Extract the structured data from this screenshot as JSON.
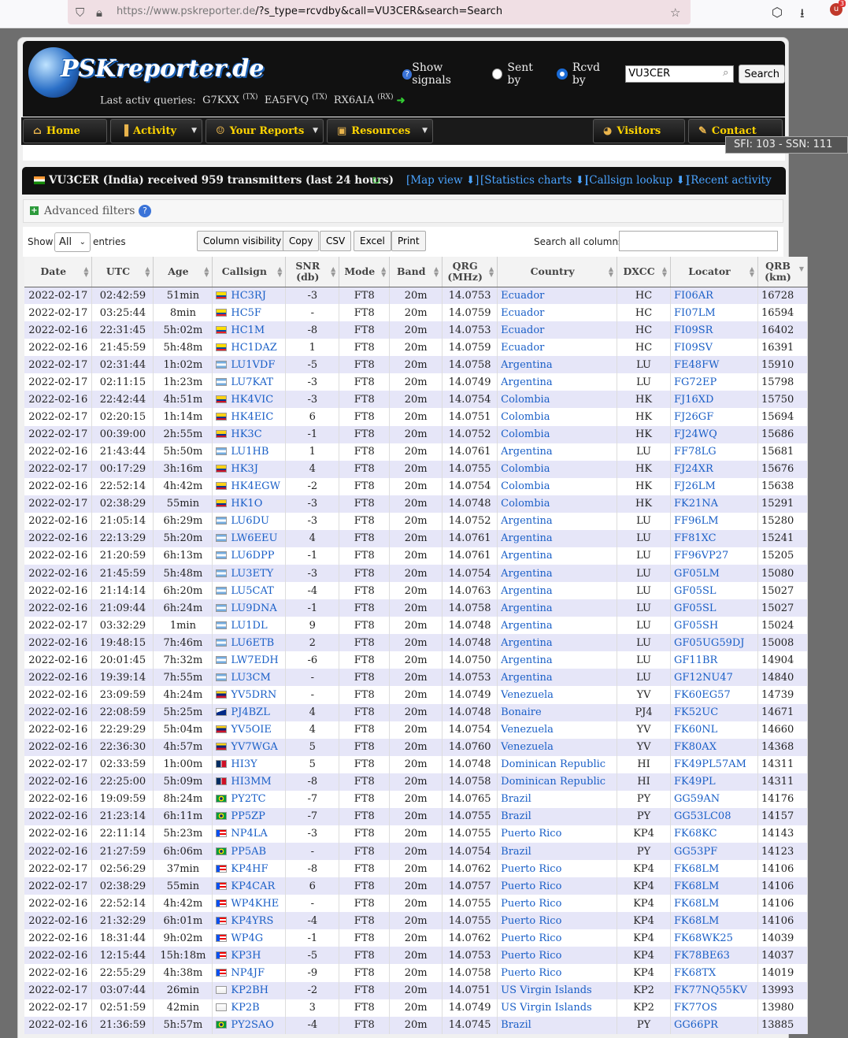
{
  "browser": {
    "url_domain": "https://www.pskreporter.de",
    "url_path": "/?s_type=rcvdby&call=VU3CER&search=Search",
    "ext_count": "3"
  },
  "header": {
    "logo": "PSKreporter.de",
    "last_label": "Last activ queries:",
    "last_queries": [
      {
        "call": "G7KXX",
        "tag": "(TX)"
      },
      {
        "call": "EA5FVQ",
        "tag": "(TX)"
      },
      {
        "call": "RX6AIA",
        "tag": "(RX)"
      }
    ],
    "show_signals": "Show signals",
    "sent_by": "Sent by",
    "rcvd_by": "Rcvd by",
    "call_value": "VU3CER",
    "search_btn": "Search"
  },
  "nav": {
    "home": "Home",
    "activity": "Activity",
    "reports": "Your Reports",
    "resources": "Resources",
    "visitors": "Visitors",
    "contact": "Contact"
  },
  "ssn": "SFI: 103 - SSN: 111",
  "titlebar": {
    "title": "VU3CER (India)   received 959 transmitters (last 24 hours)",
    "map": "[Map view ⬇]",
    "stats": "[Statistics charts ⬇]",
    "lookup": "[Callsign lookup ⬇]",
    "recent": "[Recent activity ⬇]"
  },
  "filters": {
    "label": "Advanced filters"
  },
  "controls": {
    "show": "Show",
    "entries_val": "All",
    "entries": "entries",
    "colvis": "Column visibility",
    "copy": "Copy",
    "csv": "CSV",
    "excel": "Excel",
    "print": "Print",
    "search_label": "Search all columns:"
  },
  "columns": [
    "Date",
    "UTC",
    "Age",
    "Callsign",
    "SNR\n(db)",
    "Mode",
    "Band",
    "QRG\n(MHz)",
    "Country",
    "DXCC",
    "Locator",
    "QRB\n(km)"
  ],
  "colors": {
    "link": "#1a5fc7",
    "odd_row": "#e6e6f8",
    "nav_text": "#ffd400"
  },
  "rows": [
    [
      "2022-02-17",
      "02:42:59",
      "51min",
      "HC3RJ",
      "-3",
      "FT8",
      "20m",
      "14.0753",
      "Ecuador",
      "HC",
      "FI06AR",
      "16728"
    ],
    [
      "2022-02-17",
      "03:25:44",
      "8min",
      "HC5F",
      "-",
      "FT8",
      "20m",
      "14.0759",
      "Ecuador",
      "HC",
      "FI07LM",
      "16594"
    ],
    [
      "2022-02-16",
      "22:31:45",
      "5h:02m",
      "HC1M",
      "-8",
      "FT8",
      "20m",
      "14.0753",
      "Ecuador",
      "HC",
      "FI09SR",
      "16402"
    ],
    [
      "2022-02-16",
      "21:45:59",
      "5h:48m",
      "HC1DAZ",
      "1",
      "FT8",
      "20m",
      "14.0759",
      "Ecuador",
      "HC",
      "FI09SV",
      "16391"
    ],
    [
      "2022-02-17",
      "02:31:44",
      "1h:02m",
      "LU1VDF",
      "-5",
      "FT8",
      "20m",
      "14.0758",
      "Argentina",
      "LU",
      "FE48FW",
      "15910"
    ],
    [
      "2022-02-17",
      "02:11:15",
      "1h:23m",
      "LU7KAT",
      "-3",
      "FT8",
      "20m",
      "14.0749",
      "Argentina",
      "LU",
      "FG72EP",
      "15798"
    ],
    [
      "2022-02-16",
      "22:42:44",
      "4h:51m",
      "HK4VIC",
      "-3",
      "FT8",
      "20m",
      "14.0754",
      "Colombia",
      "HK",
      "FJ16XD",
      "15750"
    ],
    [
      "2022-02-17",
      "02:20:15",
      "1h:14m",
      "HK4EIC",
      "6",
      "FT8",
      "20m",
      "14.0751",
      "Colombia",
      "HK",
      "FJ26GF",
      "15694"
    ],
    [
      "2022-02-17",
      "00:39:00",
      "2h:55m",
      "HK3C",
      "-1",
      "FT8",
      "20m",
      "14.0752",
      "Colombia",
      "HK",
      "FJ24WQ",
      "15686"
    ],
    [
      "2022-02-16",
      "21:43:44",
      "5h:50m",
      "LU1HB",
      "1",
      "FT8",
      "20m",
      "14.0761",
      "Argentina",
      "LU",
      "FF78LG",
      "15681"
    ],
    [
      "2022-02-17",
      "00:17:29",
      "3h:16m",
      "HK3J",
      "4",
      "FT8",
      "20m",
      "14.0755",
      "Colombia",
      "HK",
      "FJ24XR",
      "15676"
    ],
    [
      "2022-02-16",
      "22:52:14",
      "4h:42m",
      "HK4EGW",
      "-2",
      "FT8",
      "20m",
      "14.0754",
      "Colombia",
      "HK",
      "FJ26LM",
      "15638"
    ],
    [
      "2022-02-17",
      "02:38:29",
      "55min",
      "HK1O",
      "-3",
      "FT8",
      "20m",
      "14.0748",
      "Colombia",
      "HK",
      "FK21NA",
      "15291"
    ],
    [
      "2022-02-16",
      "21:05:14",
      "6h:29m",
      "LU6DU",
      "-3",
      "FT8",
      "20m",
      "14.0752",
      "Argentina",
      "LU",
      "FF96LM",
      "15280"
    ],
    [
      "2022-02-16",
      "22:13:29",
      "5h:20m",
      "LW6EEU",
      "4",
      "FT8",
      "20m",
      "14.0761",
      "Argentina",
      "LU",
      "FF81XC",
      "15241"
    ],
    [
      "2022-02-16",
      "21:20:59",
      "6h:13m",
      "LU6DPP",
      "-1",
      "FT8",
      "20m",
      "14.0761",
      "Argentina",
      "LU",
      "FF96VP27",
      "15205"
    ],
    [
      "2022-02-16",
      "21:45:59",
      "5h:48m",
      "LU3ETY",
      "-3",
      "FT8",
      "20m",
      "14.0754",
      "Argentina",
      "LU",
      "GF05LM",
      "15080"
    ],
    [
      "2022-02-16",
      "21:14:14",
      "6h:20m",
      "LU5CAT",
      "-4",
      "FT8",
      "20m",
      "14.0763",
      "Argentina",
      "LU",
      "GF05SL",
      "15027"
    ],
    [
      "2022-02-16",
      "21:09:44",
      "6h:24m",
      "LU9DNA",
      "-1",
      "FT8",
      "20m",
      "14.0758",
      "Argentina",
      "LU",
      "GF05SL",
      "15027"
    ],
    [
      "2022-02-17",
      "03:32:29",
      "1min",
      "LU1DL",
      "9",
      "FT8",
      "20m",
      "14.0748",
      "Argentina",
      "LU",
      "GF05SH",
      "15024"
    ],
    [
      "2022-02-16",
      "19:48:15",
      "7h:46m",
      "LU6ETB",
      "2",
      "FT8",
      "20m",
      "14.0748",
      "Argentina",
      "LU",
      "GF05UG59DJ",
      "15008"
    ],
    [
      "2022-02-16",
      "20:01:45",
      "7h:32m",
      "LW7EDH",
      "-6",
      "FT8",
      "20m",
      "14.0750",
      "Argentina",
      "LU",
      "GF11BR",
      "14904"
    ],
    [
      "2022-02-16",
      "19:39:14",
      "7h:55m",
      "LU3CM",
      "-",
      "FT8",
      "20m",
      "14.0753",
      "Argentina",
      "LU",
      "GF12NU47",
      "14840"
    ],
    [
      "2022-02-16",
      "23:09:59",
      "4h:24m",
      "YV5DRN",
      "-",
      "FT8",
      "20m",
      "14.0749",
      "Venezuela",
      "YV",
      "FK60EG57",
      "14739"
    ],
    [
      "2022-02-16",
      "22:08:59",
      "5h:25m",
      "PJ4BZL",
      "4",
      "FT8",
      "20m",
      "14.0748",
      "Bonaire",
      "PJ4",
      "FK52UC",
      "14671"
    ],
    [
      "2022-02-16",
      "22:29:29",
      "5h:04m",
      "YV5OIE",
      "4",
      "FT8",
      "20m",
      "14.0754",
      "Venezuela",
      "YV",
      "FK60NL",
      "14660"
    ],
    [
      "2022-02-16",
      "22:36:30",
      "4h:57m",
      "YV7WGA",
      "5",
      "FT8",
      "20m",
      "14.0760",
      "Venezuela",
      "YV",
      "FK80AX",
      "14368"
    ],
    [
      "2022-02-17",
      "02:33:59",
      "1h:00m",
      "HI3Y",
      "5",
      "FT8",
      "20m",
      "14.0748",
      "Dominican Republic",
      "HI",
      "FK49PL57AM",
      "14311"
    ],
    [
      "2022-02-16",
      "22:25:00",
      "5h:09m",
      "HI3MM",
      "-8",
      "FT8",
      "20m",
      "14.0758",
      "Dominican Republic",
      "HI",
      "FK49PL",
      "14311"
    ],
    [
      "2022-02-16",
      "19:09:59",
      "8h:24m",
      "PY2TC",
      "-7",
      "FT8",
      "20m",
      "14.0765",
      "Brazil",
      "PY",
      "GG59AN",
      "14176"
    ],
    [
      "2022-02-16",
      "21:23:14",
      "6h:11m",
      "PP5ZP",
      "-7",
      "FT8",
      "20m",
      "14.0755",
      "Brazil",
      "PY",
      "GG53LC08",
      "14157"
    ],
    [
      "2022-02-16",
      "22:11:14",
      "5h:23m",
      "NP4LA",
      "-3",
      "FT8",
      "20m",
      "14.0755",
      "Puerto Rico",
      "KP4",
      "FK68KC",
      "14143"
    ],
    [
      "2022-02-16",
      "21:27:59",
      "6h:06m",
      "PP5AB",
      "-",
      "FT8",
      "20m",
      "14.0754",
      "Brazil",
      "PY",
      "GG53PF",
      "14123"
    ],
    [
      "2022-02-17",
      "02:56:29",
      "37min",
      "KP4HF",
      "-8",
      "FT8",
      "20m",
      "14.0762",
      "Puerto Rico",
      "KP4",
      "FK68LM",
      "14106"
    ],
    [
      "2022-02-17",
      "02:38:29",
      "55min",
      "KP4CAR",
      "6",
      "FT8",
      "20m",
      "14.0757",
      "Puerto Rico",
      "KP4",
      "FK68LM",
      "14106"
    ],
    [
      "2022-02-16",
      "22:52:14",
      "4h:42m",
      "WP4KHE",
      "-",
      "FT8",
      "20m",
      "14.0755",
      "Puerto Rico",
      "KP4",
      "FK68LM",
      "14106"
    ],
    [
      "2022-02-16",
      "21:32:29",
      "6h:01m",
      "KP4YRS",
      "-4",
      "FT8",
      "20m",
      "14.0755",
      "Puerto Rico",
      "KP4",
      "FK68LM",
      "14106"
    ],
    [
      "2022-02-16",
      "18:31:44",
      "9h:02m",
      "WP4G",
      "-1",
      "FT8",
      "20m",
      "14.0762",
      "Puerto Rico",
      "KP4",
      "FK68WK25",
      "14039"
    ],
    [
      "2022-02-16",
      "12:15:44",
      "15h:18m",
      "KP3H",
      "-5",
      "FT8",
      "20m",
      "14.0753",
      "Puerto Rico",
      "KP4",
      "FK78BE63",
      "14037"
    ],
    [
      "2022-02-16",
      "22:55:29",
      "4h:38m",
      "NP4JF",
      "-9",
      "FT8",
      "20m",
      "14.0758",
      "Puerto Rico",
      "KP4",
      "FK68TX",
      "14019"
    ],
    [
      "2022-02-17",
      "03:07:44",
      "26min",
      "KP2BH",
      "-2",
      "FT8",
      "20m",
      "14.0751",
      "US Virgin Islands",
      "KP2",
      "FK77NQ55KV",
      "13993"
    ],
    [
      "2022-02-17",
      "02:51:59",
      "42min",
      "KP2B",
      "3",
      "FT8",
      "20m",
      "14.0749",
      "US Virgin Islands",
      "KP2",
      "FK77OS",
      "13980"
    ],
    [
      "2022-02-16",
      "21:36:59",
      "5h:57m",
      "PY2SAO",
      "-4",
      "FT8",
      "20m",
      "14.0745",
      "Brazil",
      "PY",
      "GG66PR",
      "13885"
    ]
  ]
}
